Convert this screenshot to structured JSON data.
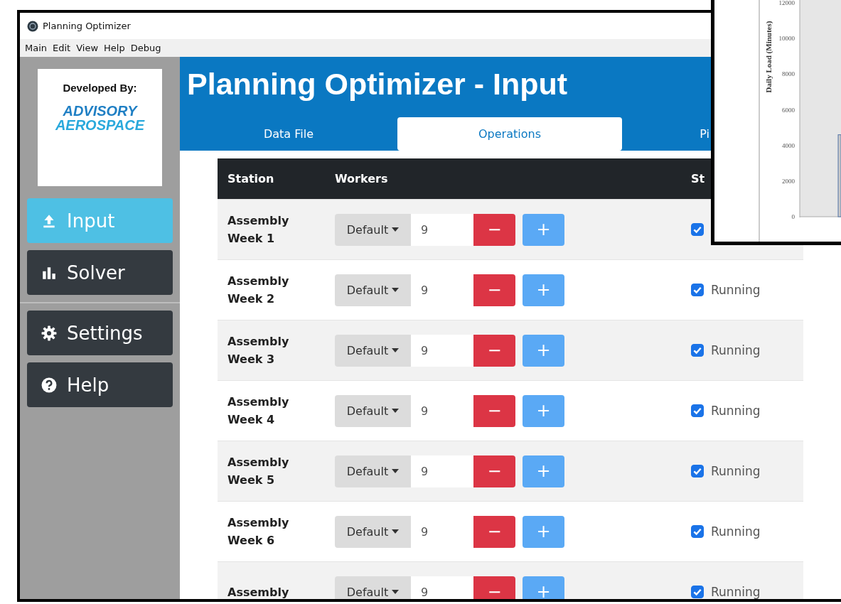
{
  "window": {
    "title": "Planning Optimizer"
  },
  "menu": [
    "Main",
    "Edit",
    "View",
    "Help",
    "Debug"
  ],
  "sidebar": {
    "credit": "Developed By:",
    "logo_lines": [
      "ADVISORY",
      "AEROSPACE"
    ],
    "items": [
      {
        "label": "Input",
        "kind": "upload",
        "selected": true
      },
      {
        "label": "Solver",
        "kind": "chart",
        "selected": false
      },
      {
        "label": "Settings",
        "kind": "gear",
        "selected": false
      },
      {
        "label": "Help",
        "kind": "question",
        "selected": false
      }
    ]
  },
  "header": {
    "title": "Planning Optimizer - Input",
    "tabs": [
      {
        "label": "Data File",
        "selected": false
      },
      {
        "label": "Operations",
        "selected": true
      },
      {
        "label": "Pi",
        "selected": false
      }
    ]
  },
  "table": {
    "columns": [
      "Station",
      "Workers",
      "St"
    ],
    "rows": [
      {
        "station": [
          "Assembly",
          "Week 1"
        ],
        "mode": "Default",
        "workers": "9",
        "minus": "−",
        "plus": "+",
        "checked": true
      },
      {
        "station": [
          "Assembly",
          "Week 2"
        ],
        "mode": "Default",
        "workers": "9",
        "minus": "−",
        "plus": "+",
        "checked": true,
        "status": "Running"
      },
      {
        "station": [
          "Assembly",
          "Week 3"
        ],
        "mode": "Default",
        "workers": "9",
        "minus": "−",
        "plus": "+",
        "checked": true,
        "status": "Running"
      },
      {
        "station": [
          "Assembly",
          "Week 4"
        ],
        "mode": "Default",
        "workers": "9",
        "minus": "−",
        "plus": "+",
        "checked": true,
        "status": "Running"
      },
      {
        "station": [
          "Assembly",
          "Week 5"
        ],
        "mode": "Default",
        "workers": "9",
        "minus": "−",
        "plus": "+",
        "checked": true,
        "status": "Running"
      },
      {
        "station": [
          "Assembly",
          "Week 6"
        ],
        "mode": "Default",
        "workers": "9",
        "minus": "−",
        "plus": "+",
        "checked": true,
        "status": "Running"
      },
      {
        "station": [
          "Assembly"
        ],
        "mode": "Default",
        "workers": "9",
        "minus": "−",
        "plus": "+",
        "checked": true,
        "status": "Running"
      }
    ]
  },
  "inset": {
    "chart_data": {
      "type": "bar",
      "ylabel": "Daily Load (Minutes)",
      "ylim": [
        0,
        12000
      ],
      "yticks": [
        0,
        2000,
        4000,
        6000,
        8000,
        10000,
        12000
      ],
      "values": [
        4600
      ]
    }
  }
}
